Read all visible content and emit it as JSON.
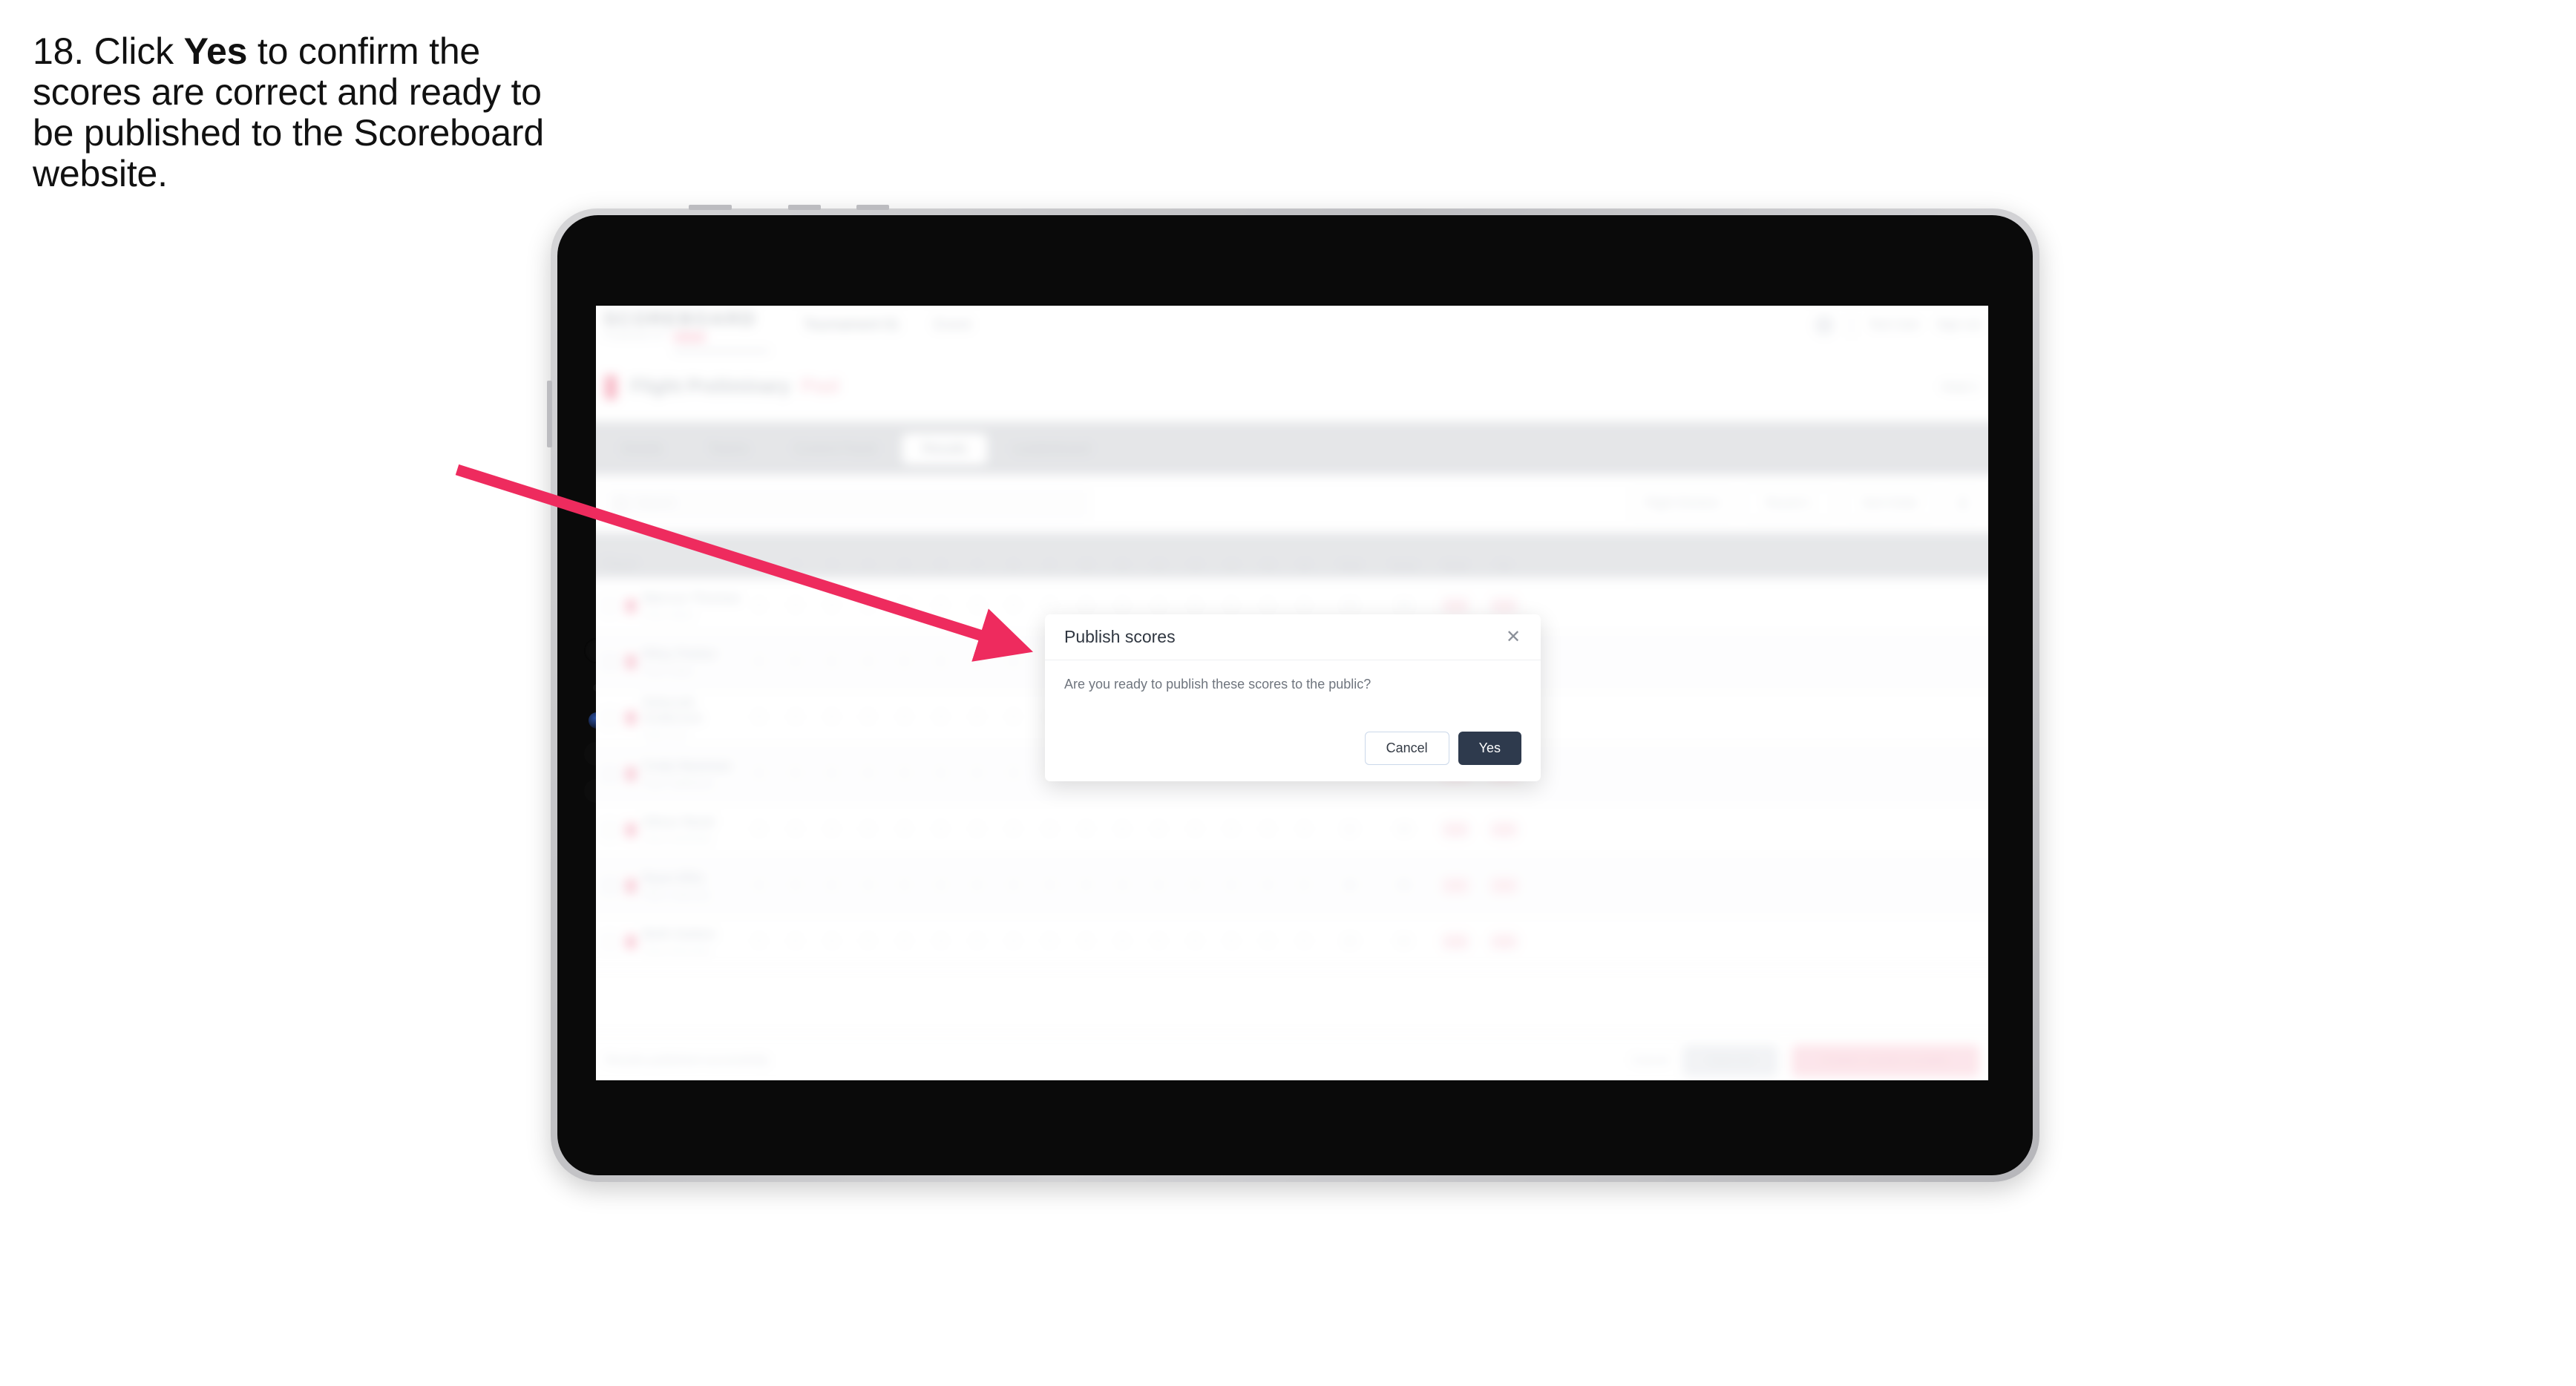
{
  "instruction": {
    "prefix": "18. Click ",
    "emphasis": "Yes",
    "suffix": " to confirm the scores are correct and ready to be published to the Scoreboard website."
  },
  "colors": {
    "arrow": "#EE2B5E",
    "yes_button": "#2E3A4D",
    "cancel_border": "#CBD8EA",
    "brand_pink": "#F2889F"
  },
  "modal": {
    "title": "Publish scores",
    "body": "Are you ready to publish these scores to the public?",
    "cancel_label": "Cancel",
    "yes_label": "Yes",
    "close_glyph": "✕"
  },
  "app": {
    "logo": "SCOREBOARD",
    "logo_sub": "POWERED BY",
    "nav": [
      {
        "label": "Tournament 01"
      },
      {
        "label": "Event"
      }
    ],
    "header_links": [
      {
        "label": "Test User"
      },
      {
        "label": "Sign out"
      }
    ],
    "title": {
      "main": "Flight Preliminary",
      "accent": "Pool",
      "right": "Heat 1"
    },
    "tabs": [
      {
        "label": "Details",
        "active": false
      },
      {
        "label": "Teams",
        "active": false
      },
      {
        "label": "Control Panel",
        "active": false
      },
      {
        "label": "Results",
        "active": true
      },
      {
        "label": "Leaderboard",
        "active": false
      }
    ],
    "search": {
      "placeholder": "Search"
    },
    "filters": [
      {
        "label": "Flight Division"
      },
      {
        "label": "Round 1"
      },
      {
        "label": "Sort Order"
      }
    ],
    "filter_icon": "☰",
    "table": {
      "player_header": "Player",
      "score_headers": [
        "1",
        "2",
        "3",
        "4",
        "5",
        "6",
        "7",
        "8",
        "9",
        "10",
        "11",
        "12",
        "13",
        "14",
        "15",
        "16"
      ],
      "summary_headers": [
        "Total",
        "Score",
        "Rank",
        "Pts"
      ],
      "rows": [
        {
          "name": "Marcus Thomas",
          "sub": "Team Alpha",
          "scores": [
            "0",
            "0",
            "0",
            "0",
            "0",
            "0",
            "0",
            "0",
            "0",
            "0",
            "0",
            "0",
            "0",
            "0",
            "0",
            "0"
          ],
          "total": "40",
          "score": "96",
          "rank": "160",
          "pts": "100"
        },
        {
          "name": "Riley Parker",
          "sub": "Team Delta",
          "scores": [
            "0",
            "0",
            "0",
            "0",
            "0",
            "0",
            "0",
            "0",
            "0",
            "0",
            "0",
            "0",
            "0",
            "0",
            "0",
            "0"
          ],
          "total": "38",
          "score": "94",
          "rank": "158",
          "pts": "100"
        },
        {
          "name": "Deborah Anderson",
          "sub": "Team One",
          "scores": [
            "0",
            "0",
            "0",
            "0",
            "0",
            "0",
            "0",
            "0",
            "0",
            "0",
            "0",
            "0",
            "0",
            "0",
            "0",
            "0"
          ],
          "total": "36",
          "score": "92",
          "rank": "156",
          "pts": "100"
        },
        {
          "name": "Cody Newman",
          "sub": "Team Highlands",
          "scores": [
            "0",
            "0",
            "0",
            "0",
            "0",
            "0",
            "0",
            "0",
            "0",
            "0",
            "0",
            "0",
            "0",
            "0",
            "0",
            "0"
          ],
          "total": "34",
          "score": "90",
          "rank": "154",
          "pts": "100"
        },
        {
          "name": "Oliver Reed",
          "sub": "Team Northside",
          "scores": [
            "0",
            "0",
            "0",
            "0",
            "0",
            "0",
            "0",
            "0",
            "0",
            "0",
            "0",
            "0",
            "0",
            "0",
            "0",
            "0"
          ],
          "total": "32",
          "score": "88",
          "rank": "152",
          "pts": "100"
        },
        {
          "name": "Ryan Ellis",
          "sub": "Team Lakeview",
          "scores": [
            "0",
            "0",
            "0",
            "0",
            "0",
            "0",
            "0",
            "0",
            "0",
            "0",
            "0",
            "0",
            "0",
            "0",
            "0",
            "0"
          ],
          "total": "30",
          "score": "86",
          "rank": "150",
          "pts": "100"
        },
        {
          "name": "Beth Sutton",
          "sub": "Team Riverside",
          "scores": [
            "0",
            "0",
            "0",
            "0",
            "0",
            "0",
            "0",
            "0",
            "0",
            "0",
            "0",
            "0",
            "0",
            "0",
            "0",
            "0"
          ],
          "total": "28",
          "score": "84",
          "rank": "148",
          "pts": "100"
        }
      ]
    },
    "footer": {
      "note": "Results published successfully",
      "link": "Cancel",
      "secondary_button": "Save All",
      "primary_button": "Publish results to public"
    }
  }
}
